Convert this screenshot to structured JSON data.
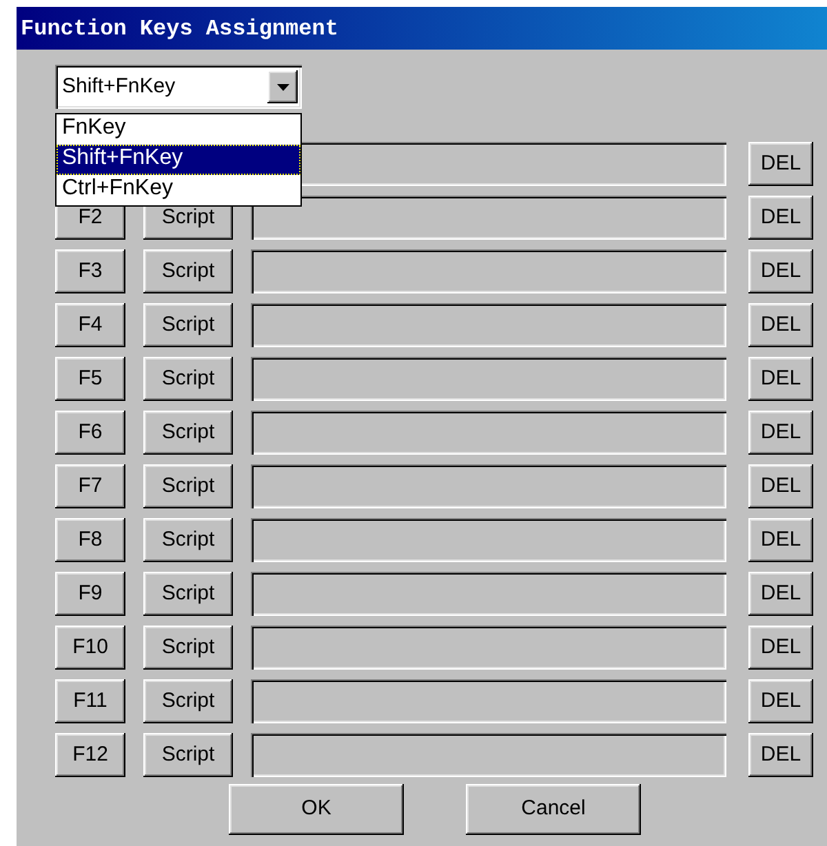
{
  "window": {
    "title": "Function Keys Assignment"
  },
  "modifier_combo": {
    "value": "Shift+FnKey",
    "expanded": true,
    "options": [
      {
        "label": "FnKey",
        "selected": false
      },
      {
        "label": "Shift+FnKey",
        "selected": true
      },
      {
        "label": "Ctrl+FnKey",
        "selected": false
      }
    ]
  },
  "rows": [
    {
      "delete": "DEL"
    },
    {
      "key": "F2",
      "script": "Script",
      "delete": "DEL"
    },
    {
      "key": "F3",
      "script": "Script",
      "delete": "DEL"
    },
    {
      "key": "F4",
      "script": "Script",
      "delete": "DEL"
    },
    {
      "key": "F5",
      "script": "Script",
      "delete": "DEL"
    },
    {
      "key": "F6",
      "script": "Script",
      "delete": "DEL"
    },
    {
      "key": "F7",
      "script": "Script",
      "delete": "DEL"
    },
    {
      "key": "F8",
      "script": "Script",
      "delete": "DEL"
    },
    {
      "key": "F9",
      "script": "Script",
      "delete": "DEL"
    },
    {
      "key": "F10",
      "script": "Script",
      "delete": "DEL"
    },
    {
      "key": "F11",
      "script": "Script",
      "delete": "DEL"
    },
    {
      "key": "F12",
      "script": "Script",
      "delete": "DEL"
    }
  ],
  "buttons": [
    "OK",
    "Cancel"
  ]
}
